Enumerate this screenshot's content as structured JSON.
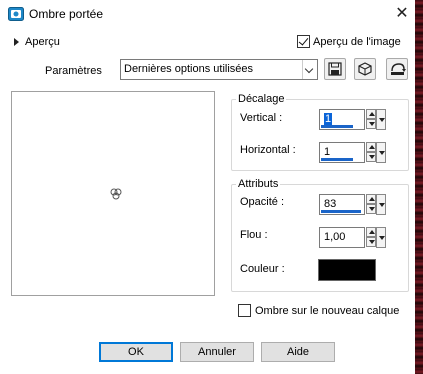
{
  "window": {
    "title": "Ombre portée",
    "close_glyph": "✕"
  },
  "preview_toggle": {
    "label": "Aperçu"
  },
  "preview_on_image": {
    "label": "Aperçu de l'image",
    "checked": true
  },
  "params": {
    "label": "Paramètres",
    "selected": "Dernières options utilisées"
  },
  "tools": [
    {
      "icon": "save-preset-icon"
    },
    {
      "icon": "preset-options-icon"
    },
    {
      "icon": "reset-icon"
    }
  ],
  "offset_group": {
    "title": "Décalage",
    "vertical": {
      "label": "Vertical :",
      "value": "1"
    },
    "horizontal": {
      "label": "Horizontal :",
      "value": "1"
    }
  },
  "attributes_group": {
    "title": "Attributs",
    "opacity": {
      "label": "Opacité :",
      "value": "83"
    },
    "blur": {
      "label": "Flou :",
      "value": "1,00"
    },
    "color": {
      "label": "Couleur :",
      "value": "#000000"
    }
  },
  "shadow_new_layer": {
    "label": "Ombre sur le nouveau calque",
    "checked": false
  },
  "buttons": {
    "ok": "OK",
    "cancel": "Annuler",
    "help": "Aide"
  },
  "colors": {
    "accent": "#0078d7",
    "selection": "#0a64d8",
    "icon_blue": "#1e88c8"
  }
}
